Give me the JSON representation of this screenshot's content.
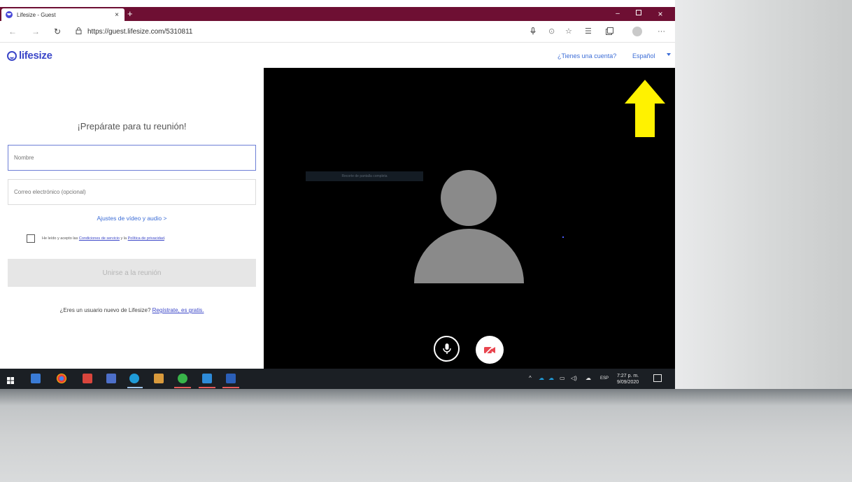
{
  "browser": {
    "tab_title": "Lifesize - Guest",
    "tab_close": "×",
    "new_tab": "+",
    "url": "https://guest.lifesize.com/5310811",
    "window_controls": {
      "minimize": "–",
      "maximize": "▫",
      "close": "×"
    }
  },
  "app": {
    "logo_text": "lifesize",
    "account_link": "¿Tienes una cuenta?",
    "language": "Español",
    "title": "¡Prepárate para tu reunión!",
    "name_placeholder": "Nombre",
    "email_placeholder": "Correo electrónico (opcional)",
    "av_settings_link": "Ajustes de vídeo y audio >",
    "terms_prefix": "He leído y acepto las",
    "terms_link": "Condiciones de servicio",
    "terms_mid": "y la",
    "privacy_link": "Política de privacidad",
    "terms_suffix": ".",
    "join_button": "Unirse a la reunión",
    "new_user_text": "¿Eres un usuario nuevo de Lifesize?",
    "register_link": "Regístrate, es gratis."
  },
  "video": {
    "tooltip": "Recorte de pantalla completa"
  },
  "taskbar": {
    "tray_lang": "ESP",
    "time": "7:27 p. m.",
    "date": "9/09/2020"
  },
  "colors": {
    "tab_strip": "#6e0f33",
    "brand": "#3b46c8",
    "link": "#3b6cd6",
    "arrow": "#fff200",
    "camera_off": "#e8454f"
  }
}
